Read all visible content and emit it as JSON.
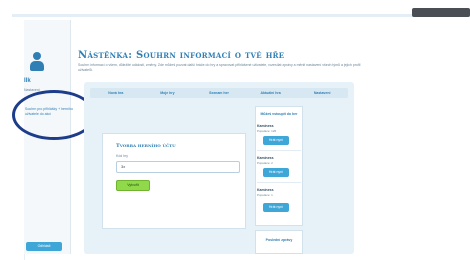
{
  "left_nav": {
    "name": "Ilk",
    "sub_label": "Nastaveni",
    "active_link": "Souhrn pro přihlášky + herního uživatele do akcí",
    "bottom_button": "Odhlásit"
  },
  "header": {
    "title": "Nástěnka: Souhrn informací o tvé hře",
    "description": "Souhrn informací o všem, důležité události, změny. Zde můžeš pozvat další hráče do hry a spravovat přihlášené uživatele, rozesílat zprávy a měnit nastavení všech týmů a jejich profil uživatelů."
  },
  "tabs": [
    {
      "label": "Nová hra"
    },
    {
      "label": "Moje hry"
    },
    {
      "label": "Seznam her"
    },
    {
      "label": "Aktuální hra"
    },
    {
      "label": "Nastavení"
    }
  ],
  "create_game": {
    "heading": "Tvorba herního účtu",
    "field_label": "Kód hry",
    "input_value": "3x",
    "button_label": "Vytvořit"
  },
  "games_panel": {
    "title": "Můžeš vstoupit do her",
    "items": [
      {
        "title": "Kaminess",
        "players": "Populace: 126",
        "button": "Hrát nyní"
      },
      {
        "title": "Kaminess",
        "players": "Populace: 2",
        "button": "Hrát nyní"
      },
      {
        "title": "Kaminess",
        "players": "Populace: 1",
        "button": "Hrát nyní"
      }
    ]
  },
  "bottom_panel": {
    "title": "Poslední zprávy"
  }
}
